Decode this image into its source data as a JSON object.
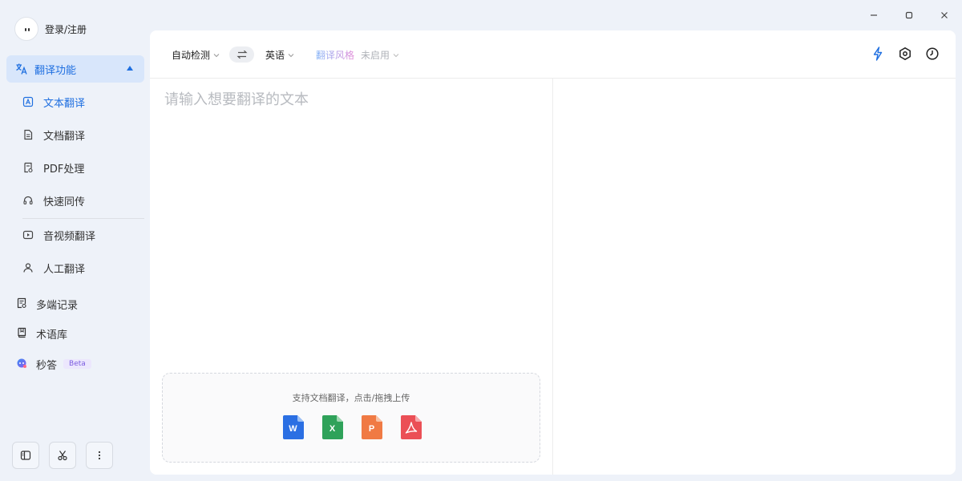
{
  "user": {
    "login_label": "登录/注册"
  },
  "sidebar": {
    "group_label": "翻译功能",
    "sub_items": [
      {
        "label": "文本翻译",
        "icon": "text-translate-icon"
      },
      {
        "label": "文档翻译",
        "icon": "document-icon"
      },
      {
        "label": "PDF处理",
        "icon": "pdf-icon"
      },
      {
        "label": "快速同传",
        "icon": "headset-icon"
      },
      {
        "label": "音视频翻译",
        "icon": "video-icon"
      },
      {
        "label": "人工翻译",
        "icon": "person-icon"
      }
    ],
    "main_items": [
      {
        "label": "多端记录",
        "icon": "record-icon"
      },
      {
        "label": "术语库",
        "icon": "book-icon"
      },
      {
        "label": "秒答",
        "icon": "ai-chat-icon",
        "badge": "Beta"
      }
    ],
    "bottom_buttons": [
      "sidebar-toggle-icon",
      "scissors-icon",
      "more-vertical-icon"
    ]
  },
  "toolbar": {
    "source_lang": "自动检测",
    "target_lang": "英语",
    "style_label": "翻译风格",
    "style_value": "未启用"
  },
  "editor": {
    "placeholder": "请输入想要翻译的文本"
  },
  "upload": {
    "hint": "支持文档翻译，点击/拖拽上传",
    "file_types": [
      {
        "letter": "W",
        "color": "#2b6fe3",
        "name": "word"
      },
      {
        "letter": "X",
        "color": "#2fa25a",
        "name": "excel"
      },
      {
        "letter": "P",
        "color": "#f07a44",
        "name": "powerpoint"
      },
      {
        "letter": "",
        "color": "#eb4f56",
        "name": "pdf"
      }
    ]
  },
  "colors": {
    "accent": "#1f6fe0",
    "active_bg": "#d8e6fb",
    "app_bg": "#eef2f9"
  }
}
